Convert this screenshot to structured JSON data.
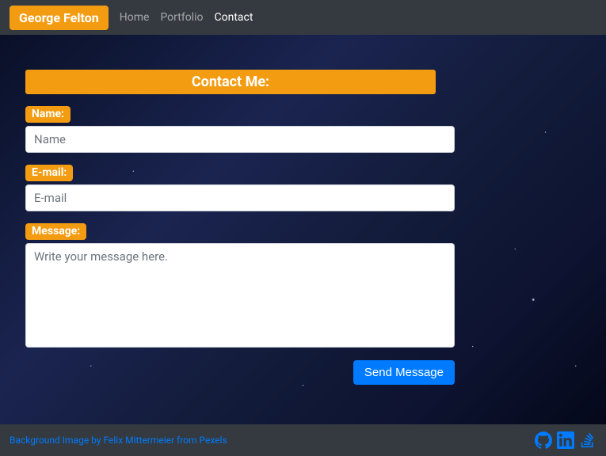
{
  "navbar": {
    "brand": "George Felton",
    "links": [
      {
        "label": "Home",
        "active": false
      },
      {
        "label": "Portfolio",
        "active": false
      },
      {
        "label": "Contact",
        "active": true
      }
    ]
  },
  "heading": "Contact Me:",
  "form": {
    "name": {
      "label": "Name:",
      "placeholder": "Name"
    },
    "email": {
      "label": "E-mail:",
      "placeholder": "E-mail"
    },
    "message": {
      "label": "Message:",
      "placeholder": "Write your message here."
    },
    "submit": "Send Message"
  },
  "footer": {
    "credit": "Background Image by Felix Mittermeier from Pexels",
    "social": [
      "github",
      "linkedin",
      "stackoverflow"
    ]
  },
  "colors": {
    "accent": "#f39c12",
    "primary": "#007bff",
    "navbar": "#343a40"
  }
}
